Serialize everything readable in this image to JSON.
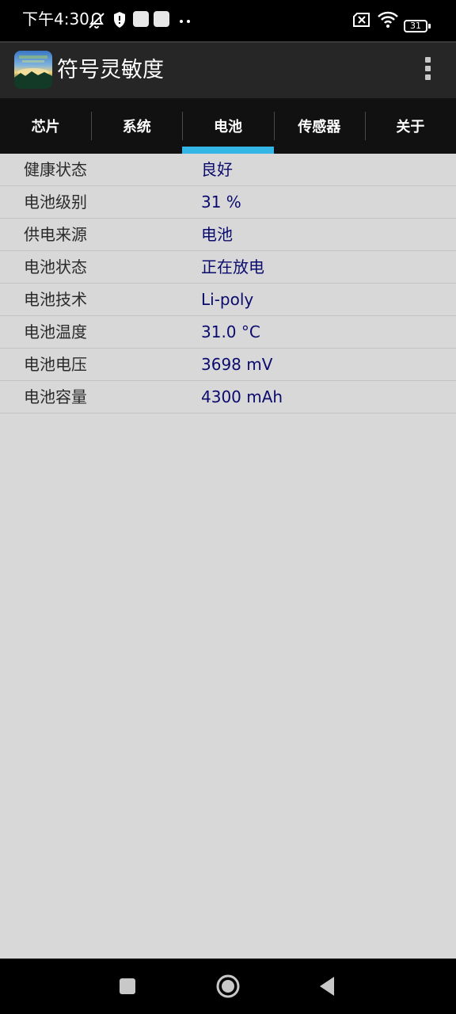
{
  "status_bar": {
    "time": "下午4:30",
    "battery_level": "31",
    "icons": [
      "notification-muted-icon",
      "shield-icon",
      "app-notification-icon",
      "app-notification-icon",
      "more-notifications-icon",
      "no-sim-icon",
      "wifi-icon",
      "battery-icon"
    ]
  },
  "app_bar": {
    "title": "符号灵敏度",
    "icon": "app-logo-icon",
    "overflow_icon": "overflow-menu-icon"
  },
  "tabs": [
    {
      "label": "芯片",
      "active": false
    },
    {
      "label": "系统",
      "active": false
    },
    {
      "label": "电池",
      "active": true
    },
    {
      "label": "传感器",
      "active": false
    },
    {
      "label": "关于",
      "active": false
    }
  ],
  "battery_info": [
    {
      "label": "健康状态",
      "value": "良好"
    },
    {
      "label": "电池级别",
      "value": "31 %"
    },
    {
      "label": "供电来源",
      "value": "电池"
    },
    {
      "label": "电池状态",
      "value": "正在放电"
    },
    {
      "label": "电池技术",
      "value": "Li-poly"
    },
    {
      "label": "电池温度",
      "value": "31.0 °C"
    },
    {
      "label": "电池电压",
      "value": "3698 mV"
    },
    {
      "label": "电池容量",
      "value": "4300 mAh"
    }
  ],
  "nav_bar": {
    "icons": [
      "recents-icon",
      "home-icon",
      "back-icon"
    ]
  },
  "colors": {
    "accent": "#33b5e5",
    "value_text": "#0b0b6e",
    "background": "#d8d8d8"
  }
}
